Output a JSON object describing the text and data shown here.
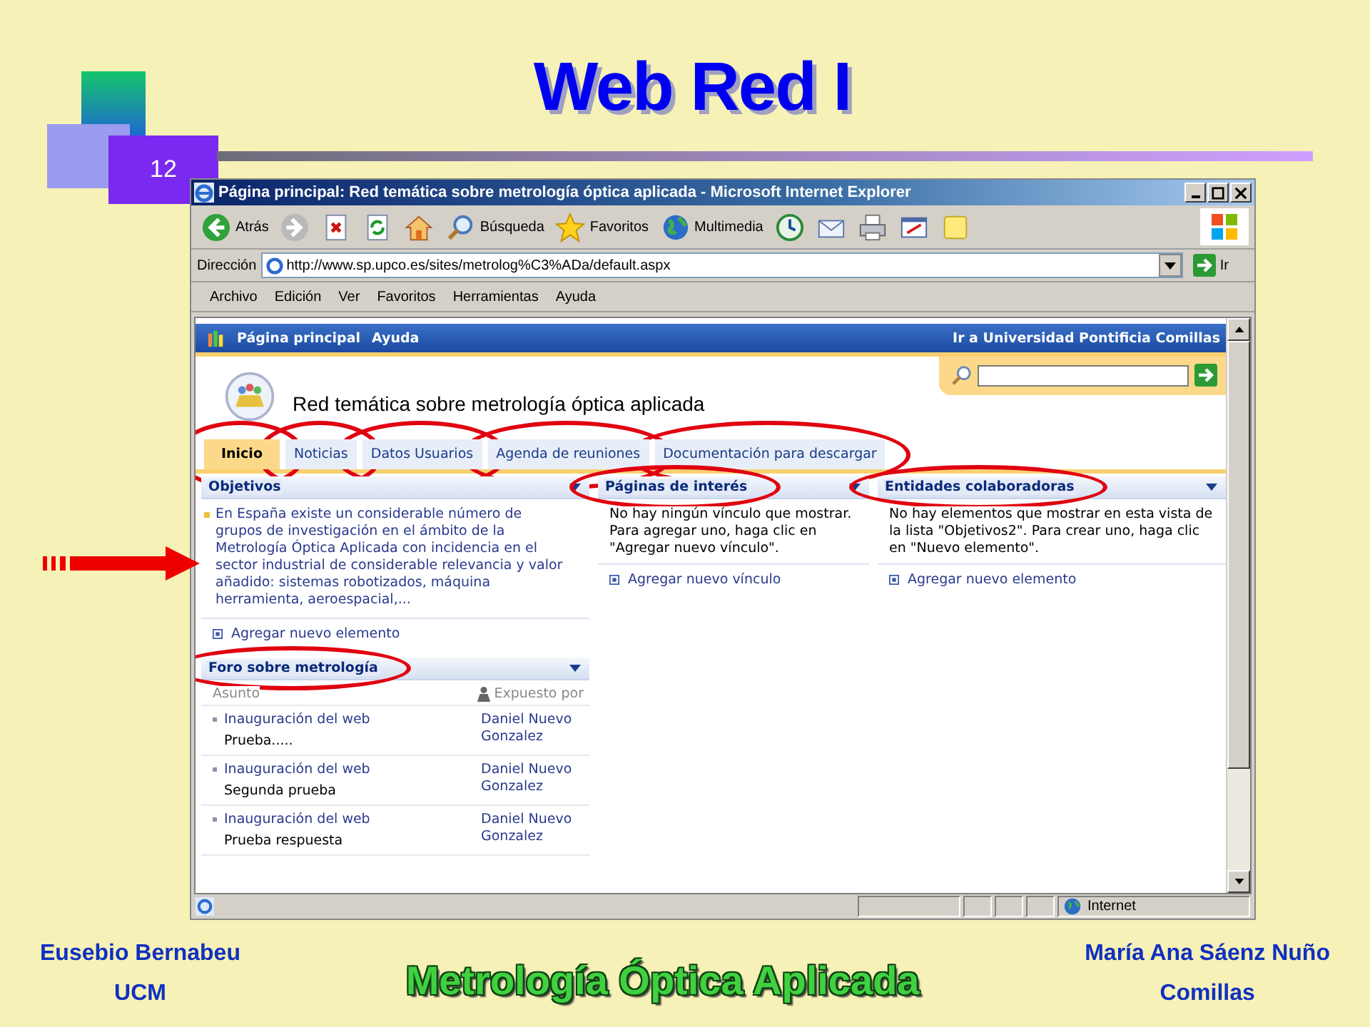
{
  "slide": {
    "title": "Web Red I",
    "number": "12",
    "footer_left": [
      "Eusebio Bernabeu",
      "UCM"
    ],
    "footer_center": "Metrología Óptica Aplicada",
    "footer_right": [
      "María Ana Sáenz Nuño",
      "Comillas"
    ]
  },
  "window": {
    "title": "Página principal: Red temática sobre metrología óptica aplicada - Microsoft Internet Explorer"
  },
  "toolbar": [
    {
      "kind": "back",
      "label": "Atrás"
    },
    {
      "kind": "forward"
    },
    {
      "kind": "stop"
    },
    {
      "kind": "refresh"
    },
    {
      "kind": "home"
    },
    {
      "kind": "search",
      "label": "Búsqueda"
    },
    {
      "kind": "favorites",
      "label": "Favoritos"
    },
    {
      "kind": "media",
      "label": "Multimedia"
    },
    {
      "kind": "history"
    },
    {
      "kind": "mail"
    },
    {
      "kind": "print"
    },
    {
      "kind": "edit"
    },
    {
      "kind": "note"
    }
  ],
  "address": {
    "label": "Dirección",
    "value": "http://www.sp.upco.es/sites/metrolog%C3%ADa/default.aspx",
    "go": "Ir"
  },
  "menu": [
    "Archivo",
    "Edición",
    "Ver",
    "Favoritos",
    "Herramientas",
    "Ayuda"
  ],
  "site": {
    "top_links": [
      "Página principal",
      "Ayuda"
    ],
    "right_link": "Ir a Universidad Pontificia Comillas",
    "title": "Red temática sobre metrología óptica aplicada"
  },
  "tabs": [
    {
      "label": "Inicio",
      "selected": true,
      "circled": true
    },
    {
      "label": "Noticias",
      "selected": false,
      "circled": true
    },
    {
      "label": "Datos Usuarios",
      "selected": false,
      "circled": true
    },
    {
      "label": "Agenda de reuniones",
      "selected": false,
      "circled": true
    },
    {
      "label": "Documentación para descargar",
      "selected": false,
      "circled": true
    }
  ],
  "columns": [
    [
      {
        "kind": "list",
        "title": "Objetivos",
        "pointer_arrow": true,
        "items": [
          "En España existe un considerable número de grupos de investigación en el ámbito de la Metrología Óptica Aplicada con incidencia en el sector industrial de considerable relevancia y valor añadido: sistemas robotizados, máquina herramienta, aeroespacial,..."
        ],
        "add_link": "Agregar nuevo elemento"
      },
      {
        "kind": "forum",
        "title": "Foro sobre metrología",
        "circled": true,
        "headers": [
          "Asunto",
          "Expuesto por"
        ],
        "rows": [
          {
            "subject": "Inauguración del web",
            "body": "Prueba.....",
            "author": "Daniel Nuevo Gonzalez"
          },
          {
            "subject": "Inauguración del web",
            "body": "Segunda prueba",
            "author": "Daniel Nuevo Gonzalez"
          },
          {
            "subject": "Inauguración del web",
            "body": "Prueba respuesta",
            "author": "Daniel Nuevo Gonzalez"
          }
        ]
      }
    ],
    [
      {
        "kind": "empty",
        "title": "Páginas de interés",
        "circled": true,
        "message": "No hay ningún vínculo que mostrar. Para agregar uno, haga clic en \"Agregar nuevo vínculo\".",
        "add_link": "Agregar nuevo vínculo"
      }
    ],
    [
      {
        "kind": "empty",
        "title": "Entidades colaboradoras",
        "circled": true,
        "message": "No hay elementos que mostrar en esta vista de la lista \"Objetivos2\". Para crear uno, haga clic en \"Nuevo elemento\".",
        "add_link": "Agregar nuevo elemento"
      }
    ]
  ],
  "status_bar": {
    "zone": "Internet"
  }
}
